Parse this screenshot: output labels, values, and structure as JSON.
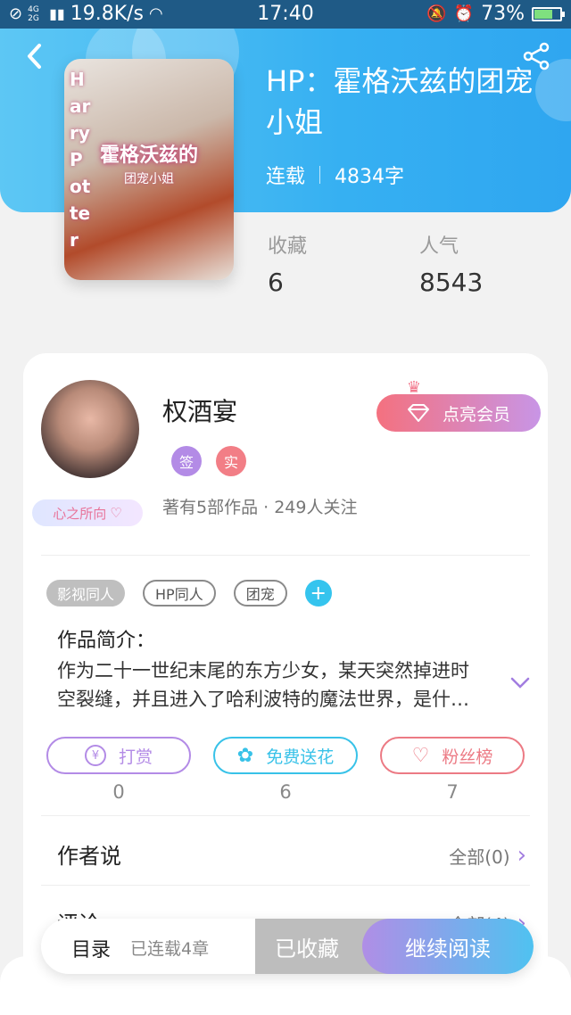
{
  "status_bar": {
    "network": "4G 2G",
    "speed": "19.8K/s",
    "time": "17:40",
    "battery_text": "73%",
    "battery_level": 0.73
  },
  "header": {
    "book_title": "HP：霍格沃兹的团宠小姐",
    "status": "连载",
    "word_count": "4834字",
    "cover": {
      "title": "霍格沃兹的",
      "subtitle": "团宠小姐",
      "side_text": "Harry Potter"
    }
  },
  "stats": [
    {
      "label": "收藏",
      "value": "6"
    },
    {
      "label": "人气",
      "value": "8543"
    }
  ],
  "author": {
    "name": "权酒宴",
    "badges": [
      "签",
      "实"
    ],
    "info": "著有5部作品 · 249人关注",
    "heart_tag": "心之所向",
    "vip_button": "点亮会员"
  },
  "tags": {
    "items": [
      "影视同人",
      "HP同人",
      "团宠"
    ],
    "add": "+"
  },
  "intro": {
    "title": "作品简介：",
    "text": "作为二十一世纪末尾的东方少女，某天突然掉进时空裂缝，并且进入了哈利波特的魔法世界，是什…"
  },
  "actions": [
    {
      "label": "打赏",
      "icon_text": "¥",
      "count": "0"
    },
    {
      "label": "免费送花",
      "icon_text": "✿",
      "count": "6"
    },
    {
      "label": "粉丝榜",
      "icon_text": "♡",
      "count": "7"
    }
  ],
  "rows": {
    "author_says": {
      "title": "作者说",
      "link": "全部(0)"
    },
    "comments": {
      "title": "评论",
      "link": "全部(4)"
    }
  },
  "bottom_bar": {
    "toc": "目录",
    "toc_sub": "已连载4章",
    "favorited": "已收藏",
    "continue": "继续阅读"
  },
  "colors": {
    "header_blue": "#36b0f2",
    "accent_purple": "#a27de0",
    "action_purple": "#b38be6",
    "action_cyan": "#38c2e8",
    "action_red": "#ec7a84"
  }
}
